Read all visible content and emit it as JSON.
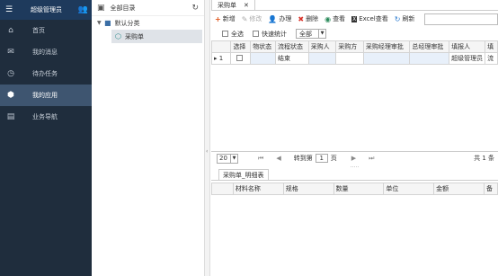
{
  "nav": {
    "user": "超级管理员",
    "items": [
      {
        "label": "首页",
        "icon": "⌂",
        "icon_name": "home-icon",
        "active": false
      },
      {
        "label": "我的消息",
        "icon": "✉",
        "icon_name": "message-icon",
        "active": false
      },
      {
        "label": "待办任务",
        "icon": "◷",
        "icon_name": "clock-icon",
        "active": false
      },
      {
        "label": "我的应用",
        "icon": "⬢",
        "icon_name": "app-cube-icon",
        "active": true
      },
      {
        "label": "业务导航",
        "icon": "▤",
        "icon_name": "navigation-icon",
        "active": false
      }
    ]
  },
  "tree": {
    "header": "全部目录",
    "default_category": "默认分类",
    "selected_node": "采购单"
  },
  "tabs": [
    {
      "label": "采购单",
      "close": "✕"
    }
  ],
  "toolbar": {
    "new": "新增",
    "edit": "修改",
    "handle": "办理",
    "delete": "删除",
    "view": "查看",
    "excel": "Excel查看",
    "refresh": "刷新"
  },
  "filter": {
    "select_all": "全选",
    "quick_stats": "快速统计",
    "status_value": "全部"
  },
  "grid": {
    "columns": [
      "",
      "选择",
      "物状态",
      "流程状态",
      "采购人",
      "采购方",
      "采购经理审批",
      "总经理审批",
      "填报人",
      "填"
    ],
    "rows": [
      {
        "indicator": "▸",
        "num": "1",
        "flow_status": "结束",
        "reporter": "超级管理员",
        "extra": "流"
      }
    ]
  },
  "pager": {
    "page_size": "20",
    "goto_label": "转到第",
    "page": "1",
    "page_suffix": "页",
    "total": "共 1 条"
  },
  "subtab": {
    "label": "采购单_明细表"
  },
  "detail_grid": {
    "columns": [
      "",
      "材料名称",
      "规格",
      "数量",
      "单位",
      "金额",
      "备"
    ]
  }
}
